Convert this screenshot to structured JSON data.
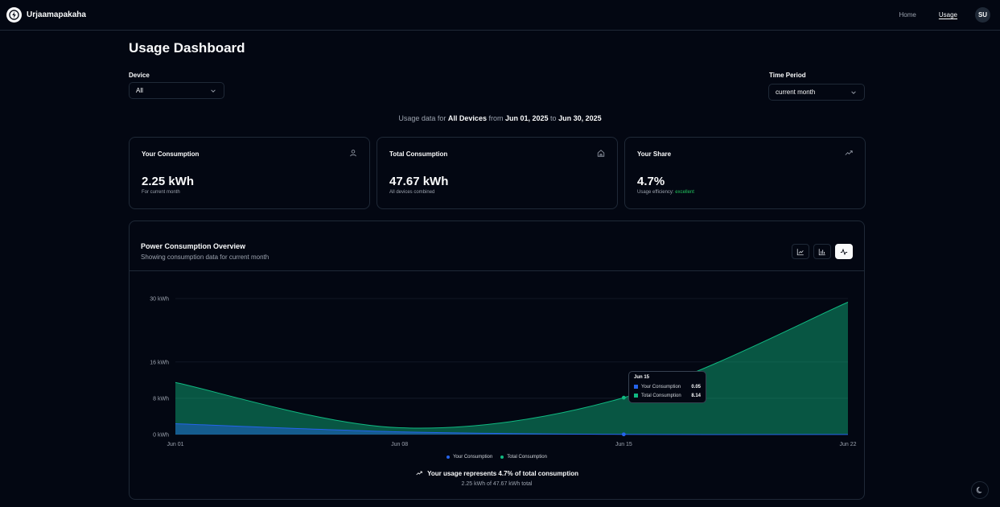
{
  "app": {
    "name": "Urjaamapakaha"
  },
  "nav": {
    "home": "Home",
    "usage": "Usage",
    "avatar": "SU"
  },
  "page": {
    "title": "Usage Dashboard"
  },
  "filters": {
    "device_label": "Device",
    "device_value": "All",
    "period_label": "Time Period",
    "period_value": "current month"
  },
  "summary": {
    "prefix": "Usage data for",
    "device": "All Devices",
    "from_word": "from",
    "start": "Jun 01, 2025",
    "to_word": "to",
    "end": "Jun 30, 2025"
  },
  "cards": [
    {
      "title": "Your Consumption",
      "icon": "user-icon",
      "value": "2.25 kWh",
      "sub": "For current month"
    },
    {
      "title": "Total Consumption",
      "icon": "home-icon",
      "value": "47.67 kWh",
      "sub": "All devices combined"
    },
    {
      "title": "Your Share",
      "icon": "trending-up-icon",
      "value": "4.7%",
      "sub": "Usage efficiency:",
      "sub_badge": "excellent"
    }
  ],
  "chart_section": {
    "title": "Power Consumption Overview",
    "description": "Showing consumption data for current month",
    "view_toggles": [
      "line-chart-icon",
      "bar-chart-icon",
      "activity-icon"
    ],
    "active_view": "activity-icon",
    "footnote": "Your usage represents 4.7% of total consumption",
    "footnote_sub": "2.25 kWh of 47.67 kWh total"
  },
  "tooltip": {
    "date": "Jun 15",
    "rows": [
      {
        "name": "Your Consumption",
        "value": "0.05"
      },
      {
        "name": "Total Consumption",
        "value": "8.14"
      }
    ]
  },
  "chart_data": {
    "type": "area",
    "x": [
      "Jun 01",
      "Jun 08",
      "Jun 15",
      "Jun 22"
    ],
    "y_ticks": [
      "0 kWh",
      "8 kWh",
      "16 kWh",
      "30 kWh"
    ],
    "y_tick_values": [
      0,
      8,
      16,
      30
    ],
    "ylim": [
      0,
      30
    ],
    "grid": true,
    "legend_position": "bottom",
    "series": [
      {
        "name": "Your Consumption",
        "color": "#2563eb",
        "values": [
          2.4,
          0.6,
          0.05,
          0.02
        ]
      },
      {
        "name": "Total Consumption",
        "color": "#10b981",
        "values": [
          11.5,
          1.5,
          8.14,
          29.2
        ]
      }
    ]
  },
  "colors": {
    "background": "#030712",
    "border": "#1f2937",
    "accent_green": "#10b981",
    "accent_blue": "#2563eb",
    "success": "#22c55e"
  }
}
